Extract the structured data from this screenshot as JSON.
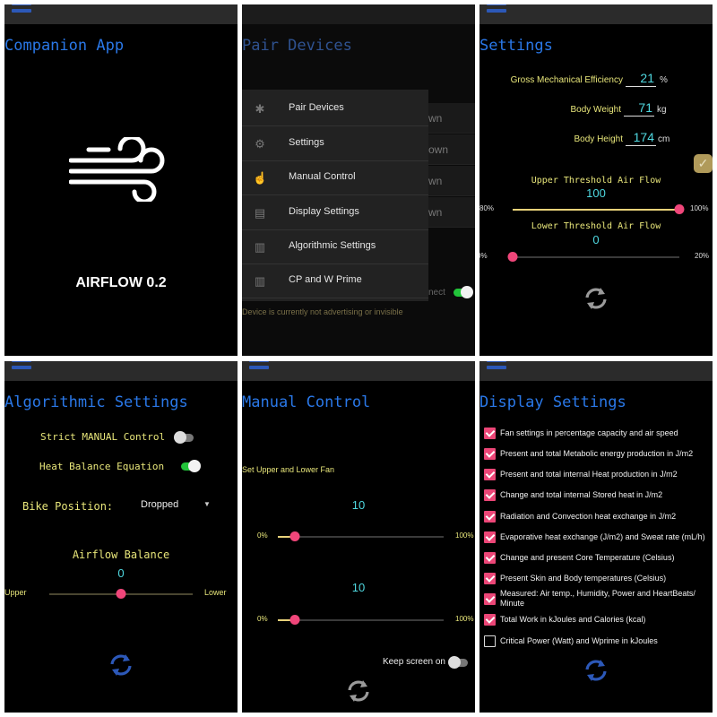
{
  "colors": {
    "title": "#2a78e8",
    "label": "#e8e67a",
    "value": "#4fd8e0",
    "thumb": "#f0467a",
    "toggle_on": "#22c43a",
    "checkbox": "#ec4677",
    "refresh_blue": "#2c58b8",
    "refresh_gray": "#9a9a9a"
  },
  "companion": {
    "title": "Companion App",
    "app_name": "AIRFLOW 0.2",
    "icon": "wind-icon"
  },
  "pair": {
    "title": "Pair Devices",
    "rows": [
      "wn",
      "own",
      "wn",
      "wn"
    ],
    "connect_label": "nect",
    "connect_on": true,
    "status": "Device is currently not advertising or invisible",
    "drawer": [
      {
        "label": "Pair Devices",
        "icon": "bluetooth-icon"
      },
      {
        "label": "Settings",
        "icon": "gear-icon"
      },
      {
        "label": "Manual Control",
        "icon": "touch-icon"
      },
      {
        "label": "Display Settings",
        "icon": "clipboard-icon"
      },
      {
        "label": "Algorithmic Settings",
        "icon": "bar-chart-icon"
      },
      {
        "label": "CP and W Prime",
        "icon": "bar-chart-icon"
      }
    ]
  },
  "settings": {
    "title": "Settings",
    "gme": {
      "label": "Gross Mechanical Efficiency",
      "value": "21",
      "unit": "%"
    },
    "weight": {
      "label": "Body Weight",
      "value": "71",
      "unit": "kg"
    },
    "height": {
      "label": "Body Height",
      "value": "174",
      "unit": "cm"
    },
    "confirm_checked": true,
    "upper": {
      "label": "Upper Threshold Air Flow",
      "value": 100,
      "value_text": "100",
      "min_label": "80%",
      "max_label": "100%",
      "min": 80,
      "max": 100
    },
    "lower": {
      "label": "Lower Threshold Air Flow",
      "value": 0,
      "value_text": "0",
      "min_label": "0%",
      "max_label": "20%",
      "min": 0,
      "max": 20
    }
  },
  "algorithmic": {
    "title": "Algorithmic Settings",
    "strict_manual": {
      "label": "Strict MANUAL Control",
      "on": false
    },
    "heat_balance": {
      "label": "Heat Balance Equation",
      "on": true
    },
    "bike_position": {
      "label": "Bike Position:",
      "value": "Dropped"
    },
    "airflow_balance": {
      "label": "Airflow Balance",
      "value_text": "0",
      "position": 0.5,
      "left_label": "Upper",
      "right_label": "Lower"
    }
  },
  "manual": {
    "title": "Manual Control",
    "subtitle": "Set Upper and Lower Fan",
    "upper_fan": {
      "value": 10,
      "value_text": "10",
      "min": 0,
      "max": 100,
      "min_label": "0%",
      "max_label": "100%"
    },
    "lower_fan": {
      "value": 10,
      "value_text": "10",
      "min": 0,
      "max": 100,
      "min_label": "0%",
      "max_label": "100%"
    },
    "keep_screen": {
      "label": "Keep screen on",
      "on": false
    }
  },
  "display": {
    "title": "Display Settings",
    "options": [
      {
        "label": "Fan settings in percentage capacity and air speed",
        "checked": true
      },
      {
        "label": "Present and total Metabolic energy production in J/m2",
        "checked": true
      },
      {
        "label": "Present and total internal Heat production in J/m2",
        "checked": true
      },
      {
        "label": "Change and total internal Stored heat in J/m2",
        "checked": true
      },
      {
        "label": "Radiation and Convection heat exchange in J/m2",
        "checked": true
      },
      {
        "label": "Evaporative heat exchange (J/m2) and Sweat  rate  (mL/h)",
        "checked": true
      },
      {
        "label": "Change and present Core Temperature (Celsius)",
        "checked": true
      },
      {
        "label": "Present Skin and Body temperatures (Celsius)",
        "checked": true
      },
      {
        "label": "Measured: Air temp., Humidity, Power and HeartBeats/ Minute",
        "checked": true
      },
      {
        "label": "Total Work in kJoules and Calories (kcal)",
        "checked": true
      },
      {
        "label": "Critical Power (Watt) and Wprime in kJoules",
        "checked": false
      }
    ]
  }
}
